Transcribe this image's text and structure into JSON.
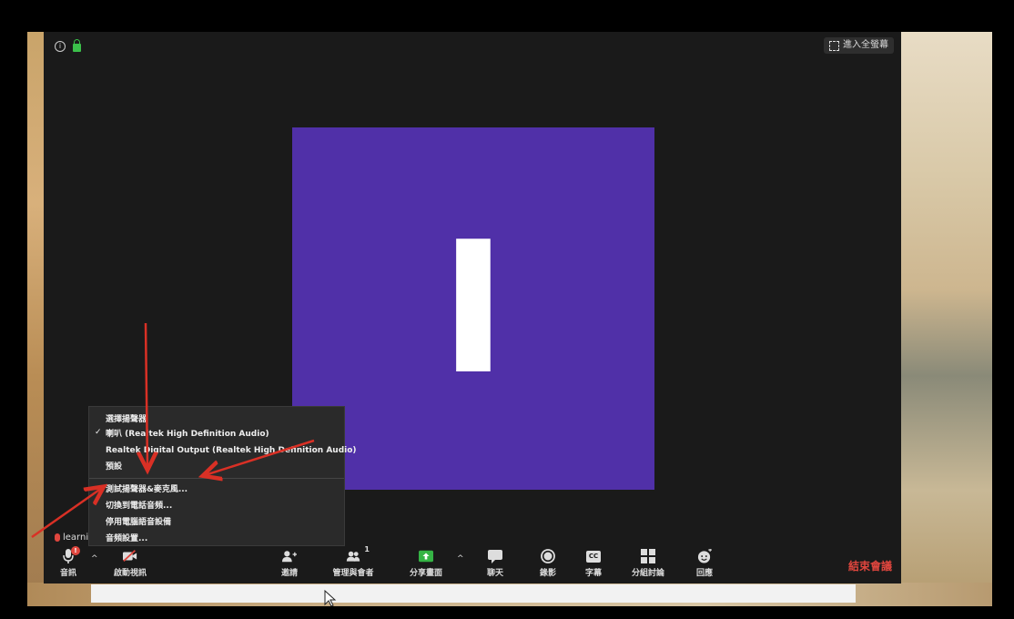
{
  "window": {
    "fullscreen_label": "進入全螢幕"
  },
  "participant": {
    "initial": "I",
    "name": "learning",
    "tile_color": "#5030a8"
  },
  "audio_menu": {
    "header": "選擇揚聲器",
    "items": [
      {
        "label": "喇叭 (Realtek High Definition Audio)",
        "checked": true
      },
      {
        "label": "Realtek Digital Output (Realtek High Definition Audio)",
        "checked": false
      },
      {
        "label": "預設",
        "checked": false
      }
    ],
    "actions": [
      {
        "label": "測試揚聲器&麥克風..."
      },
      {
        "label": "切換到電話音頻..."
      },
      {
        "label": "停用電腦語音設備"
      },
      {
        "label": "音頻設置..."
      }
    ]
  },
  "toolbar": {
    "audio": "音訊",
    "audio_badge": "!",
    "video": "啟動視訊",
    "invite": "邀請",
    "participants": "管理與會者",
    "participants_count": "1",
    "share": "分享畫面",
    "chat": "聊天",
    "record": "錄影",
    "captions": "字幕",
    "captions_icon_text": "CC",
    "breakout": "分組討論",
    "reactions": "回應",
    "end": "結束會議"
  },
  "colors": {
    "accent_end": "#e0463e",
    "share_green": "#35b445",
    "arrow_red": "#d93025"
  }
}
